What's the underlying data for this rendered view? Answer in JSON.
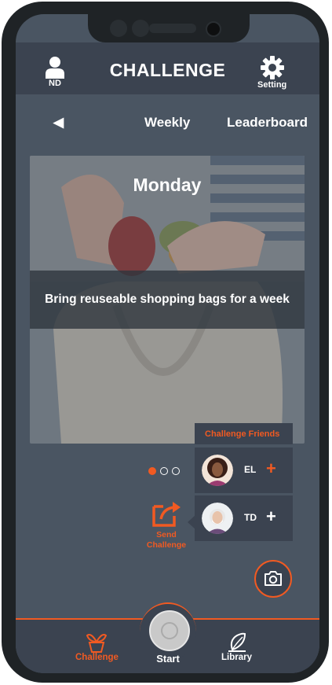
{
  "header": {
    "user_label": "ND",
    "title": "CHALLENGE",
    "setting_label": "Setting"
  },
  "nav": {
    "back_icon": "◀",
    "weekly_label": "Weekly",
    "leaderboard_label": "Leaderboard"
  },
  "challenge_card": {
    "day": "Monday",
    "text": "Bring reuseable shopping bags for a week"
  },
  "pager": {
    "count": 3,
    "active": 1
  },
  "send_challenge": {
    "label_line1": "Send",
    "label_line2": "Challenge"
  },
  "friends_panel": {
    "title": "Challenge Friends",
    "friends": [
      {
        "initials": "EL",
        "action": "+",
        "action_color": "#f15a22"
      },
      {
        "initials": "TD",
        "action": "+",
        "action_color": "#ffffff"
      }
    ]
  },
  "bottom_nav": {
    "challenge_label": "Challenge",
    "start_label": "Start",
    "library_label": "Library"
  },
  "colors": {
    "accent": "#f15a22",
    "screen_bg": "#4a5562",
    "bar_bg": "#3b4350"
  }
}
